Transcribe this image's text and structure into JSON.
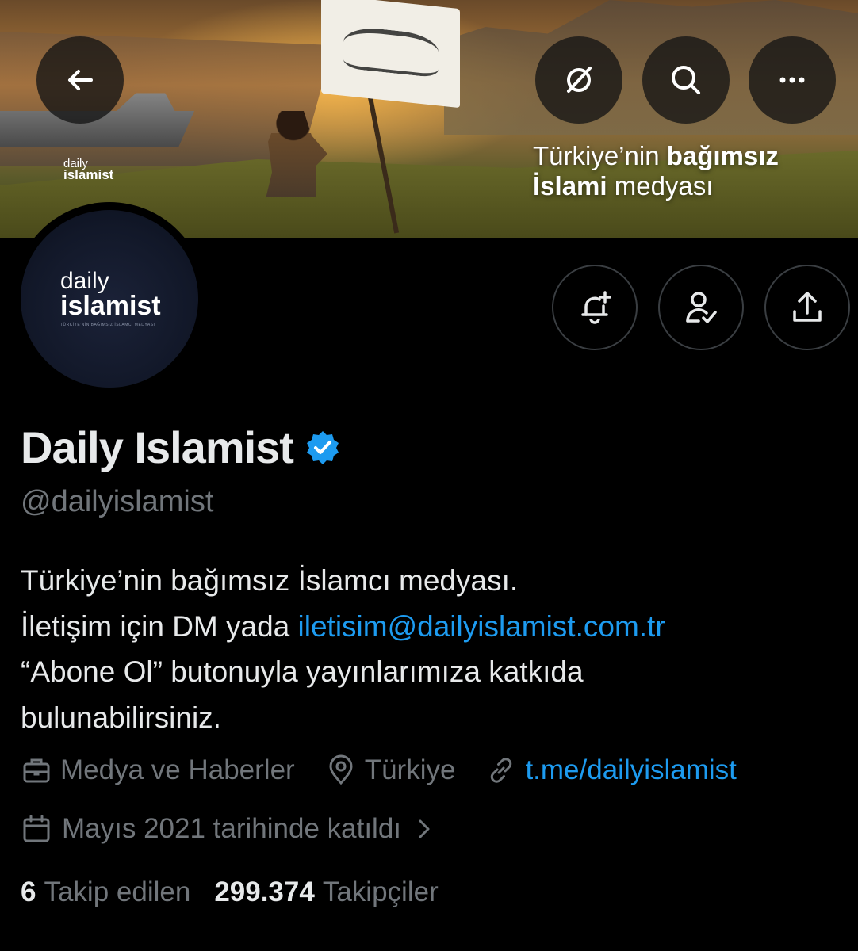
{
  "banner": {
    "logo_line1": "daily",
    "logo_line2": "islamist",
    "tagline_line1_normal": "Türkiye’nin ",
    "tagline_line1_bold": "bağımsız",
    "tagline_line2_bold": "İslami",
    "tagline_line2_normal": " medyası"
  },
  "header_buttons": {
    "back": "back-arrow-icon",
    "grok": "grok-icon",
    "search": "search-icon",
    "more": "more-icon"
  },
  "avatar": {
    "line1": "daily",
    "line2": "islamist",
    "tiny_text": "TÜRKİYE'NİN BAĞIMSIZ İSLAMCI MEDYASI"
  },
  "actions": {
    "notify_icon": "bell-plus-icon",
    "follow_icon": "person-check-icon",
    "share_icon": "share-icon"
  },
  "profile": {
    "name": "Daily Islamist",
    "handle": "@dailyislamist",
    "verified_color": "#1d9bf0"
  },
  "bio": {
    "line1": "Türkiye’nin bağımsız İslamcı medyası.",
    "line2_prefix": "İletişim için DM yada ",
    "line2_email": "iletisim@dailyislamist.com.tr",
    "line3": "“Abone Ol” butonuyla yayınlarımıza katkıda",
    "line4": "bulunabilirsiniz."
  },
  "meta": {
    "category": "Medya ve Haberler",
    "location": "Türkiye",
    "website": "t.me/dailyislamist",
    "joined": "Mayıs 2021 tarihinde katıldı"
  },
  "stats": {
    "following_count": "6",
    "following_label": "Takip edilen",
    "followers_count": "299.374",
    "followers_label": "Takipçiler"
  },
  "colors": {
    "background": "#000000",
    "text_primary": "#e7e9ea",
    "text_secondary": "#71767b",
    "accent": "#1d9bf0"
  }
}
